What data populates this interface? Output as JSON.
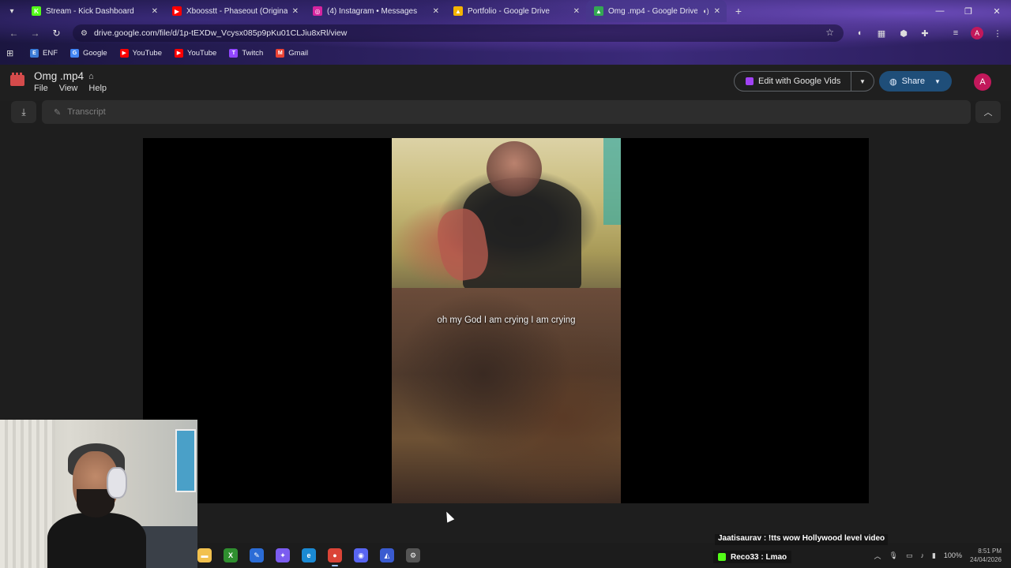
{
  "browser": {
    "tabs": [
      {
        "title": "Stream - Kick Dashboard",
        "favicon": "kick-icon",
        "color": "#53fc18",
        "glyph": "K",
        "active": false
      },
      {
        "title": "Xboosstt - Phaseout (Original",
        "favicon": "youtube-icon",
        "color": "#ff0000",
        "glyph": "▶",
        "active": false
      },
      {
        "title": "(4) Instagram • Messages",
        "favicon": "instagram-icon",
        "color": "#d6249f",
        "glyph": "◎",
        "active": false
      },
      {
        "title": "Portfolio - Google Drive",
        "favicon": "drive-icon",
        "color": "#f4b400",
        "glyph": "▲",
        "active": false
      },
      {
        "title": "Omg .mp4 - Google Drive",
        "favicon": "drive-icon",
        "color": "#34a853",
        "glyph": "▲",
        "active": true
      }
    ],
    "url": "drive.google.com/file/d/1p-tEXDw_Vcysx085p9pKu01CLJiu8xRl/view",
    "profile_initial": "A",
    "bookmarks": [
      {
        "label": "ENF",
        "icon": "enf-icon",
        "color": "#3b7bd6",
        "glyph": "E"
      },
      {
        "label": "Google",
        "icon": "google-icon",
        "color": "#4285f4",
        "glyph": "G"
      },
      {
        "label": "YouTube",
        "icon": "youtube-icon",
        "color": "#ff0000",
        "glyph": "▶"
      },
      {
        "label": "YouTube",
        "icon": "youtube-icon",
        "color": "#ff0000",
        "glyph": "▶"
      },
      {
        "label": "Twitch",
        "icon": "twitch-icon",
        "color": "#9146ff",
        "glyph": "T"
      },
      {
        "label": "Gmail",
        "icon": "gmail-icon",
        "color": "#ea4335",
        "glyph": "M"
      }
    ]
  },
  "viewer": {
    "file_name": "Omg .mp4",
    "menus": [
      "File",
      "View",
      "Help"
    ],
    "edit_vids_label": "Edit with Google Vids",
    "share_label": "Share",
    "account_initial": "A",
    "transcript_placeholder": "Transcript",
    "caption": "oh my God I am crying I am crying"
  },
  "overlay": {
    "chat_line_1": "Jaatisaurav : !tts wow Hollywood level video",
    "chat_line_2": "Reco33 : Lmao"
  },
  "taskbar": {
    "apps": [
      {
        "name": "file-explorer-icon",
        "color": "#f2c14e",
        "glyph": "▬"
      },
      {
        "name": "xbox-icon",
        "color": "#2f8f2f",
        "glyph": "X"
      },
      {
        "name": "edit-app-icon",
        "color": "#2b6cd6",
        "glyph": "✎"
      },
      {
        "name": "copilot-icon",
        "color": "#7b5cf0",
        "glyph": "✦"
      },
      {
        "name": "edge-icon",
        "color": "#1a8ad4",
        "glyph": "e"
      },
      {
        "name": "chrome-icon",
        "color": "#db4437",
        "glyph": "●"
      },
      {
        "name": "discord-icon",
        "color": "#5865f2",
        "glyph": "◉"
      },
      {
        "name": "arc-app-icon",
        "color": "#3a5bd0",
        "glyph": "◭"
      },
      {
        "name": "settings-app-icon",
        "color": "#555555",
        "glyph": "⚙"
      }
    ],
    "battery": "100%",
    "time": "8:51 PM",
    "date": "24/04/2026"
  }
}
